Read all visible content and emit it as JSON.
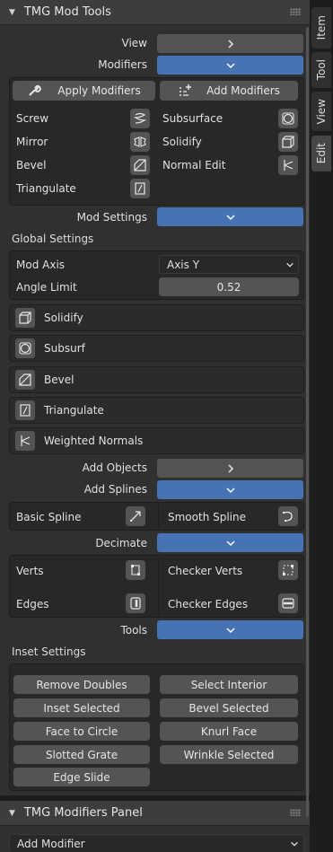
{
  "panel": {
    "title": "TMG Mod Tools"
  },
  "tabs": [
    "Item",
    "Tool",
    "View",
    "Edit"
  ],
  "rows": {
    "view": "View",
    "modifiers": "Modifiers",
    "mod_settings": "Mod Settings",
    "add_objects": "Add Objects",
    "add_splines": "Add Splines",
    "decimate": "Decimate",
    "tools": "Tools"
  },
  "modifiers_box": {
    "apply_label": "Apply Modifiers",
    "add_label": "Add Modifiers",
    "items_left": [
      "Screw",
      "Mirror",
      "Bevel",
      "Triangulate"
    ],
    "items_right": [
      "Subsurface",
      "Solidify",
      "Normal Edit"
    ]
  },
  "global_settings": {
    "title": "Global Settings",
    "mod_axis_label": "Mod Axis",
    "mod_axis_value": "Axis Y",
    "angle_limit_label": "Angle Limit",
    "angle_limit_value": "0.52"
  },
  "mod_list": [
    "Solidify",
    "Subsurf",
    "Bevel",
    "Triangulate",
    "Weighted Normals"
  ],
  "splines": {
    "basic": "Basic Spline",
    "smooth": "Smooth Spline"
  },
  "decimate_box": {
    "verts": "Verts",
    "checker_verts": "Checker Verts",
    "edges": "Edges",
    "checker_edges": "Checker Edges"
  },
  "inset": {
    "title": "Inset Settings",
    "buttons": [
      "Remove Doubles",
      "Select Interior",
      "Inset Selected",
      "Bevel Selected",
      "Face to Circle",
      "Knurl Face",
      "Slotted Grate",
      "Wrinkle Selected",
      "Edge Slide"
    ]
  },
  "panel2": {
    "title": "TMG Modifiers Panel",
    "add_modifier": "Add Modifier"
  }
}
